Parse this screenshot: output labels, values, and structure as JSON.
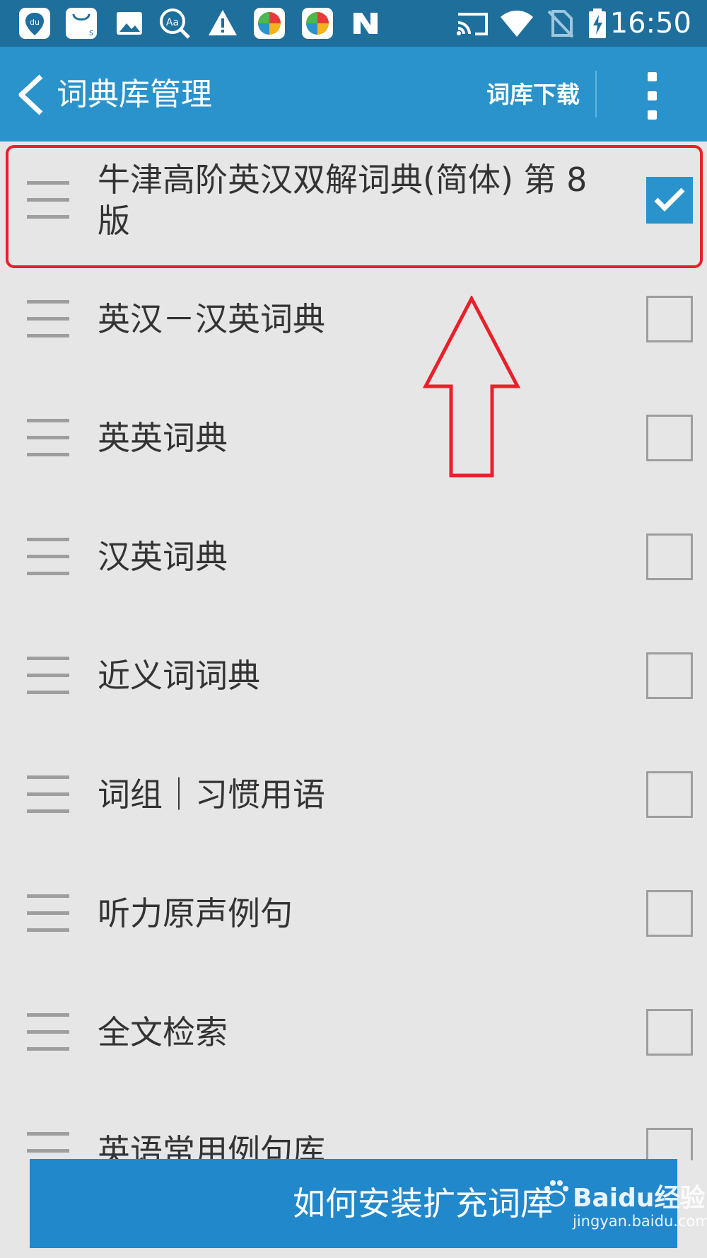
{
  "status_bar": {
    "time": "16:50",
    "left_icons": [
      "du-map-icon",
      "shopping-bag-icon",
      "image-icon",
      "search-aa-icon",
      "warning-icon",
      "pinwheel-app-icon",
      "pinwheel-app-icon-2",
      "n-icon"
    ],
    "right_icons": [
      "cast-icon",
      "wifi-icon",
      "no-sim-icon",
      "battery-charging-icon"
    ]
  },
  "app_bar": {
    "title": "词典库管理",
    "download_label": "词库下载",
    "color": "#2a93cc"
  },
  "dictionaries": [
    {
      "label": "牛津高阶英汉双解词典(简体) 第 8 版",
      "checked": true
    },
    {
      "label": "英汉－汉英词典",
      "checked": false
    },
    {
      "label": "英英词典",
      "checked": false
    },
    {
      "label": "汉英词典",
      "checked": false
    },
    {
      "label": "近义词词典",
      "checked": false
    },
    {
      "label": "词组｜习惯用语",
      "checked": false
    },
    {
      "label": "听力原声例句",
      "checked": false
    },
    {
      "label": "全文检索",
      "checked": false
    },
    {
      "label": "英语常用例句库",
      "checked": false
    }
  ],
  "bottom_button": {
    "label": "如何安装扩充词库"
  },
  "watermark": {
    "brand": "Baidu经验",
    "url": "jingyan.baidu.com"
  },
  "annotation_color": "#e8202a"
}
